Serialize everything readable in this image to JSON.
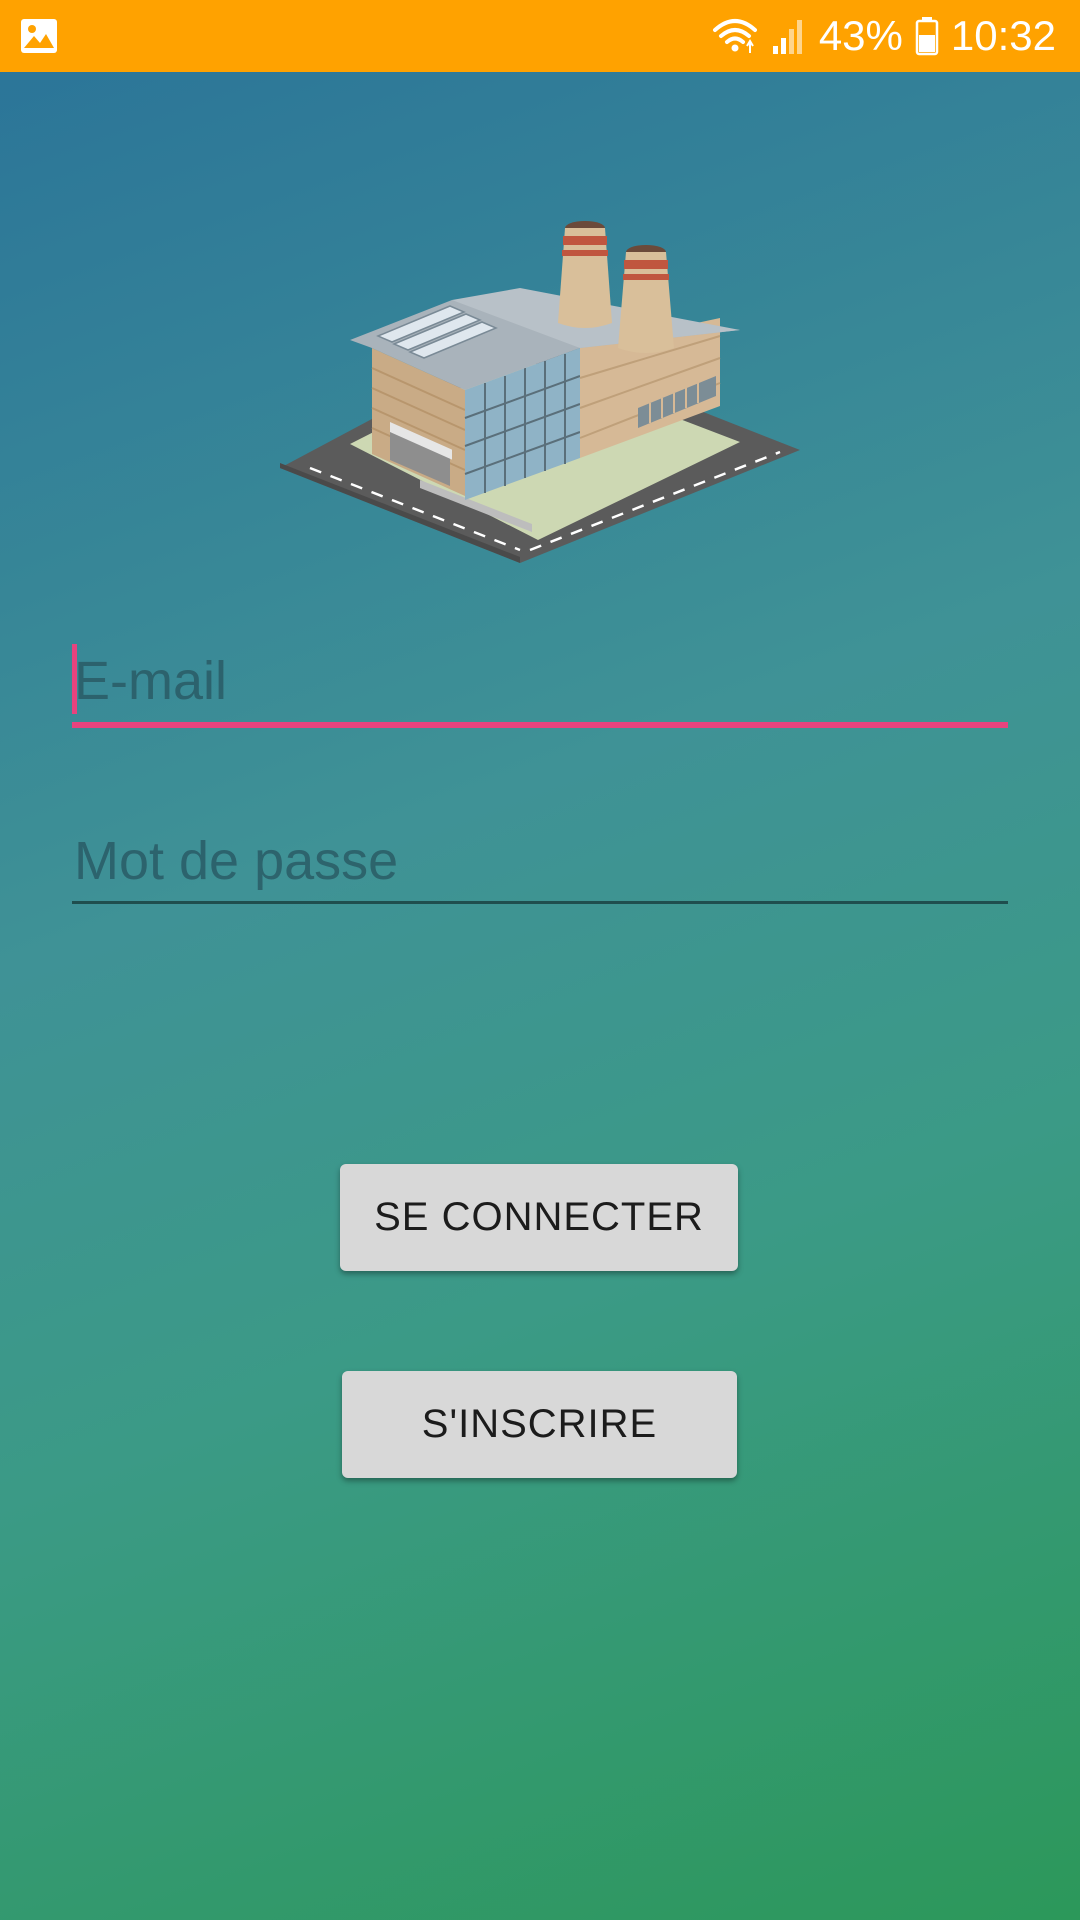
{
  "status_bar": {
    "battery_percent": "43%",
    "time": "10:32",
    "background_color": "#ffa200",
    "icons": [
      "image-notification-icon",
      "wifi-icon",
      "cellular-signal-icon",
      "battery-icon"
    ]
  },
  "logo": {
    "icon": "factory-building-icon"
  },
  "form": {
    "email_placeholder": "E-mail",
    "password_placeholder": "Mot de passe",
    "accent_color": "#e8437e"
  },
  "buttons": {
    "login_label": "SE CONNECTER",
    "signup_label": "S'INSCRIRE"
  }
}
